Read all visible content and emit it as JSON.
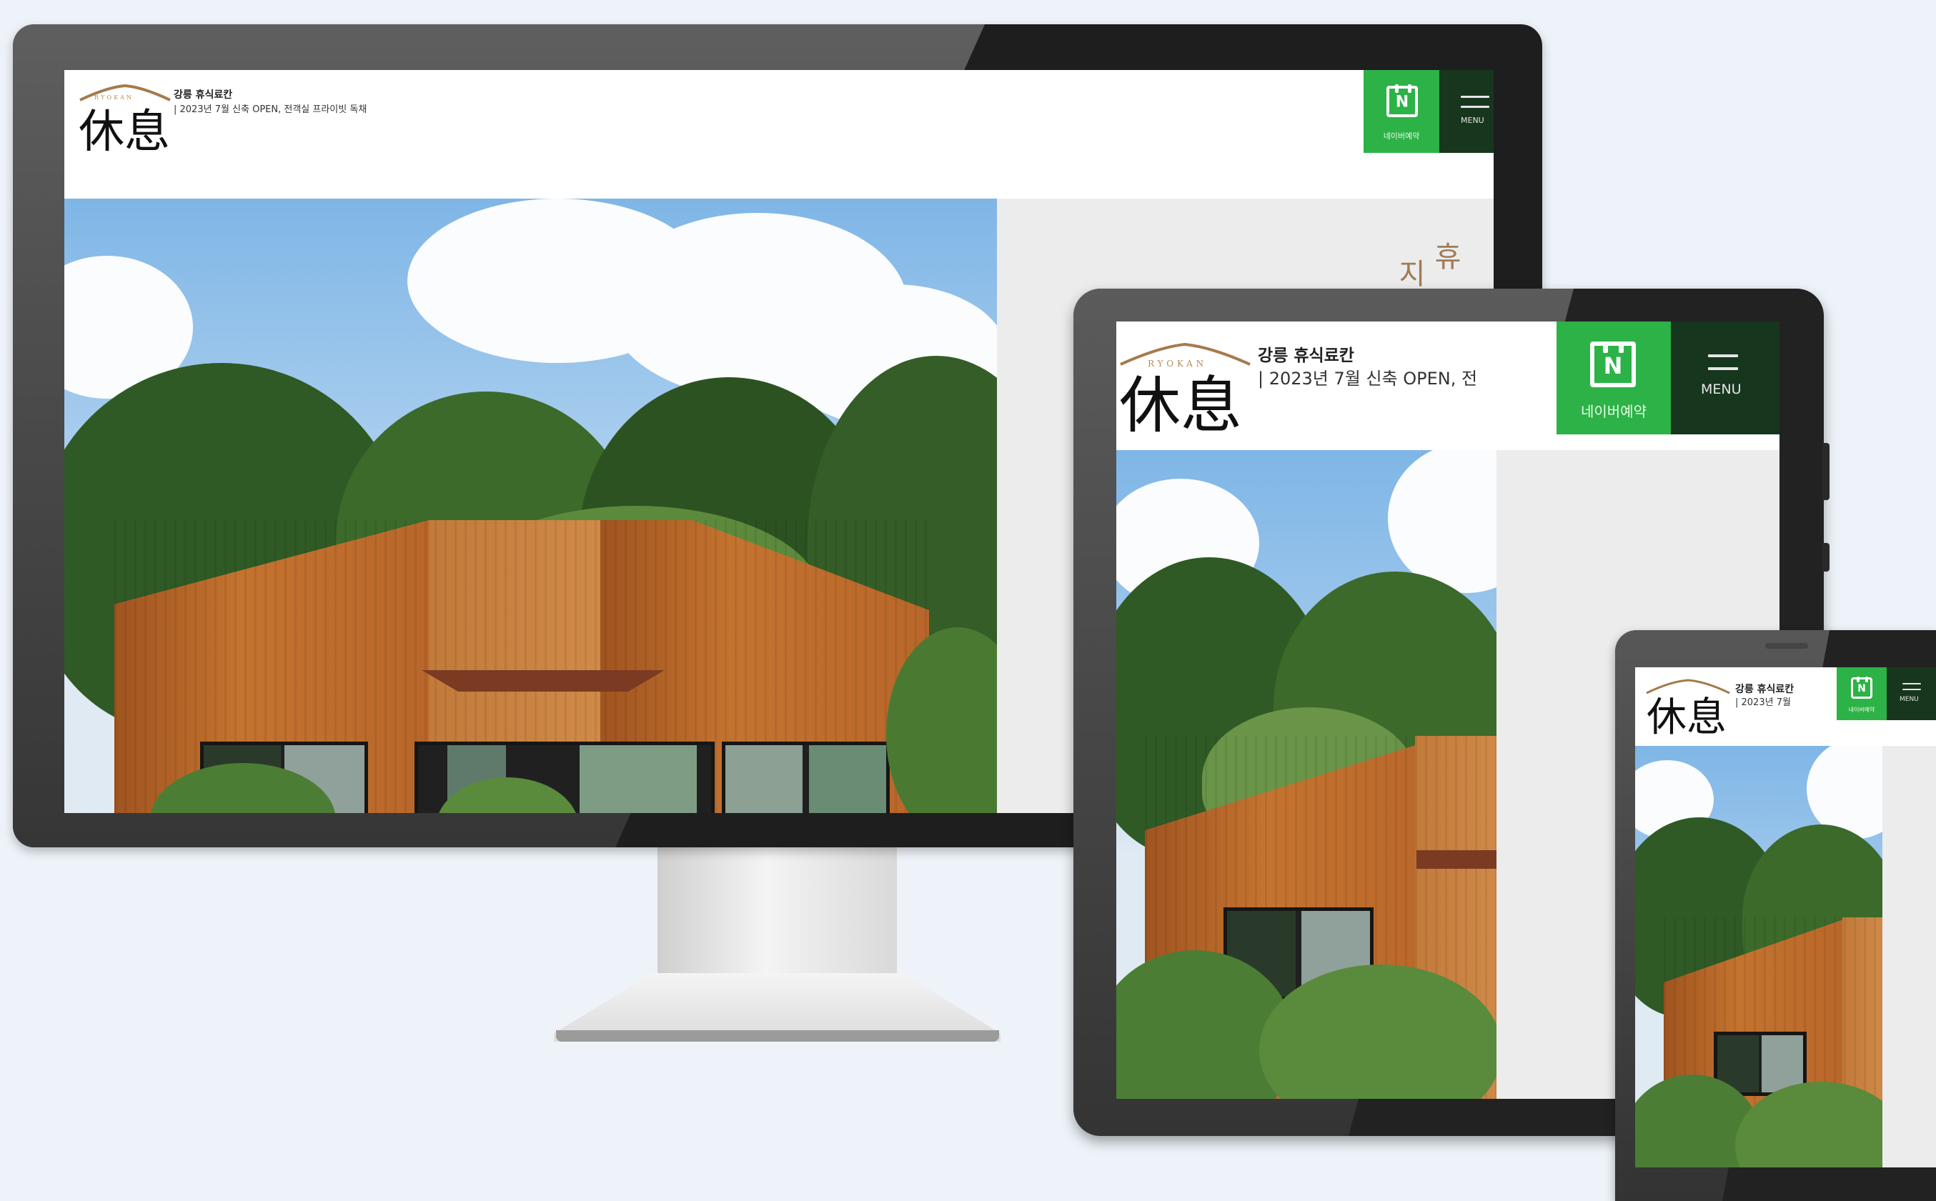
{
  "site": {
    "logo_small": "RYOKAN",
    "logo_kanji": "休息",
    "title": "강릉 휴식료칸",
    "tagline_desktop": "| 2023년 7월 신축 OPEN, 전객실 프라이빗 독채",
    "tagline_tablet": "| 2023년 7월 신축 OPEN, 전",
    "tagline_phone": "| 2023년 7월",
    "naver_icon_letter": "N",
    "naver_label": "네이버예약",
    "menu_label": "MENU",
    "desktop_menu_label": "MENU",
    "hero_vertical_text_1": "휴",
    "hero_vertical_text_2": "지"
  },
  "colors": {
    "background": "#edf3f9",
    "naver_green": "#2db247",
    "menu_dark_green": "#17361e",
    "logo_gold": "#b48c5a",
    "wood": "#b9662a"
  },
  "icons": [
    "calendar-n-icon",
    "hamburger-menu-icon"
  ]
}
